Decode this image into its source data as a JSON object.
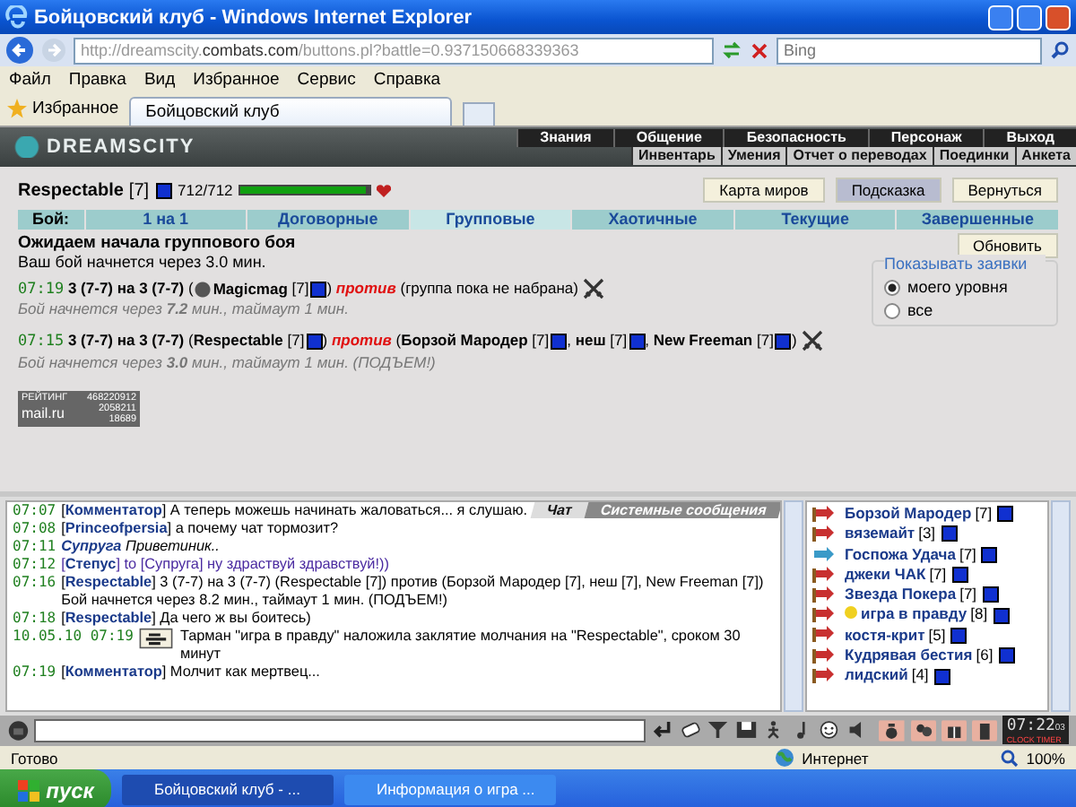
{
  "window": {
    "title": "Бойцовский клуб - Windows Internet Explorer"
  },
  "address_bar": {
    "url": "http://dreamscity.**combats.com**/buttons.pl?battle=0.937150668339363",
    "search_placeholder": "Bing"
  },
  "menu": [
    "Файл",
    "Правка",
    "Вид",
    "Избранное",
    "Сервис",
    "Справка"
  ],
  "favorites": {
    "label": "Избранное"
  },
  "tabs": [
    {
      "label": "Бойцовский клуб",
      "selected": true
    }
  ],
  "game": {
    "logo": "DREAMSCITY",
    "nav": [
      "Знания",
      "Общение",
      "Безопасность",
      "Персонаж",
      "Выход"
    ],
    "subnav": [
      "Инвентарь",
      "Умения",
      "Отчет о переводах",
      "Поединки",
      "Анкета"
    ],
    "player": {
      "name": "Respectable",
      "level": "[7]",
      "hp": "712/712",
      "hp_bar": {
        "level": 1
      }
    },
    "buttons": [
      {
        "label": "Карта миров",
        "selected": false
      },
      {
        "label": "Подсказка",
        "selected": true
      },
      {
        "label": "Вернуться",
        "selected": false
      }
    ],
    "battle_tabs": {
      "label": "Бой:",
      "items": [
        {
          "label": "1 на 1",
          "selected": false
        },
        {
          "label": "Договорные",
          "selected": false
        },
        {
          "label": "Групповые",
          "selected": true
        },
        {
          "label": "Хаотичные",
          "selected": false
        },
        {
          "label": "Текущие",
          "selected": false
        },
        {
          "label": "Завершенные",
          "selected": false
        }
      ]
    },
    "status": {
      "title": "Ожидаем начала группового боя",
      "text": "Ваш бой начнется через 3.0 мин.",
      "refresh": "Обновить"
    },
    "filter": {
      "title": "Показывать заявки",
      "options": [
        {
          "label": "моего уровня",
          "selected": true
        },
        {
          "label": "все",
          "selected": false
        }
      ]
    },
    "battles": [
      {
        "time": "07:19",
        "segments": [
          {
            "kind": "text",
            "text": "**3 (7-7) на 3 (7-7)** ("
          },
          {
            "kind": "player",
            "name": "Magicmag",
            "level": "[7]",
            "mascot": true
          },
          {
            "kind": "text",
            "text": ") "
          },
          {
            "kind": "against",
            "text": "против"
          },
          {
            "kind": "text",
            "text": " (группа пока не набрана) "
          },
          {
            "kind": "join"
          }
        ],
        "info": "Бой начнется через **7.2** мин., таймаут 1 мин."
      },
      {
        "time": "07:15",
        "segments": [
          {
            "kind": "text",
            "text": "**3 (7-7) на 3 (7-7)** ("
          },
          {
            "kind": "player",
            "name": "Respectable",
            "level": "[7]",
            "mascot": false
          },
          {
            "kind": "text",
            "text": ") "
          },
          {
            "kind": "against",
            "text": "против"
          },
          {
            "kind": "text",
            "text": " ("
          },
          {
            "kind": "player",
            "name": "Борзой Мародер",
            "level": "[7]",
            "mascot": false
          },
          {
            "kind": "text",
            "text": ", "
          },
          {
            "kind": "player",
            "name": "неш",
            "level": "[7]",
            "mascot": false
          },
          {
            "kind": "text",
            "text": ", "
          },
          {
            "kind": "player",
            "name": "New Freeman",
            "level": "[7]",
            "mascot": false
          },
          {
            "kind": "text",
            "text": ") "
          },
          {
            "kind": "join"
          }
        ],
        "info": "Бой начнется через **3.0** мин., таймаут 1 мин. (ПОДЪЕМ!)"
      }
    ],
    "counter": {
      "label": "РЕЙТИНГ",
      "brand": "mail.ru",
      "values": [
        "468220912",
        "2058211",
        "18689"
      ]
    }
  },
  "chat": {
    "tabs": [
      {
        "label": "Чат",
        "selected": true
      },
      {
        "label": "Системные сообщения",
        "selected": false
      }
    ],
    "messages": [
      {
        "kind": "say",
        "time": "07:07",
        "text": "[**Комментатор**] А теперь можешь начинать жаловаться... я слушаю."
      },
      {
        "kind": "say",
        "time": "07:08",
        "text": "[**Princeofpersia**] а почему чат тормозит?"
      },
      {
        "kind": "emote",
        "time": "07:11",
        "text": "**Супруга** Приветиник.."
      },
      {
        "kind": "private",
        "time": "07:12",
        "text": "[**Степус**] to [Супруга] ну здраствуй здравствуй!))"
      },
      {
        "kind": "say",
        "time": "07:16",
        "text": "[**Respectable**] 3 (7-7) на 3 (7-7) (Respectable [7]) против (Борзой Мародер [7], неш [7], New Freeman [7]) Бой начнется через 8.2 мин., таймаут 1 мин. (ПОДЪЕМ!)"
      },
      {
        "kind": "say",
        "time": "07:18",
        "text": "[**Respectable**] Да чего ж вы боитесь)"
      },
      {
        "kind": "system",
        "time": "10.05.10 07:19",
        "text": "Тарман \"игра в правду\" наложила заклятие молчания на \"Respectable\", сроком 30 минут"
      },
      {
        "kind": "say",
        "time": "07:19",
        "text": "[**Комментатор**] Молчит как мертвец..."
      }
    ],
    "users": [
      {
        "kind": "fighter",
        "name": "Борзой Мародер",
        "level": "[7]",
        "silenced": false
      },
      {
        "kind": "fighter",
        "name": "вяземайт",
        "level": "[3]",
        "silenced": false
      },
      {
        "kind": "guide",
        "name": "Госпожа Удача",
        "level": "[7]",
        "silenced": false
      },
      {
        "kind": "fighter",
        "name": "джеки ЧАК",
        "level": "[7]",
        "silenced": false
      },
      {
        "kind": "fighter",
        "name": "Звезда Покера",
        "level": "[7]",
        "silenced": false
      },
      {
        "kind": "fighter",
        "name": "игра в правду",
        "level": "[8]",
        "silenced": true
      },
      {
        "kind": "fighter",
        "name": "костя-крит",
        "level": "[5]",
        "silenced": false
      },
      {
        "kind": "fighter",
        "name": "Кудрявая бестия",
        "level": "[6]",
        "silenced": false
      },
      {
        "kind": "fighter",
        "name": "лидский",
        "level": "[4]",
        "silenced": false
      }
    ]
  },
  "toolbar": {
    "clock": "07:22",
    "seconds": "03",
    "clock_label": "CLOCK",
    "timer_label": "TIMER"
  },
  "status_bar": {
    "text": "Готово",
    "zone": "Интернет",
    "zoom": "100%"
  },
  "taskbar": {
    "start": "пуск",
    "items": [
      {
        "label": "Бойцовский клуб - ...",
        "selected": true
      },
      {
        "label": "Информация о игра ...",
        "selected": false
      }
    ]
  }
}
